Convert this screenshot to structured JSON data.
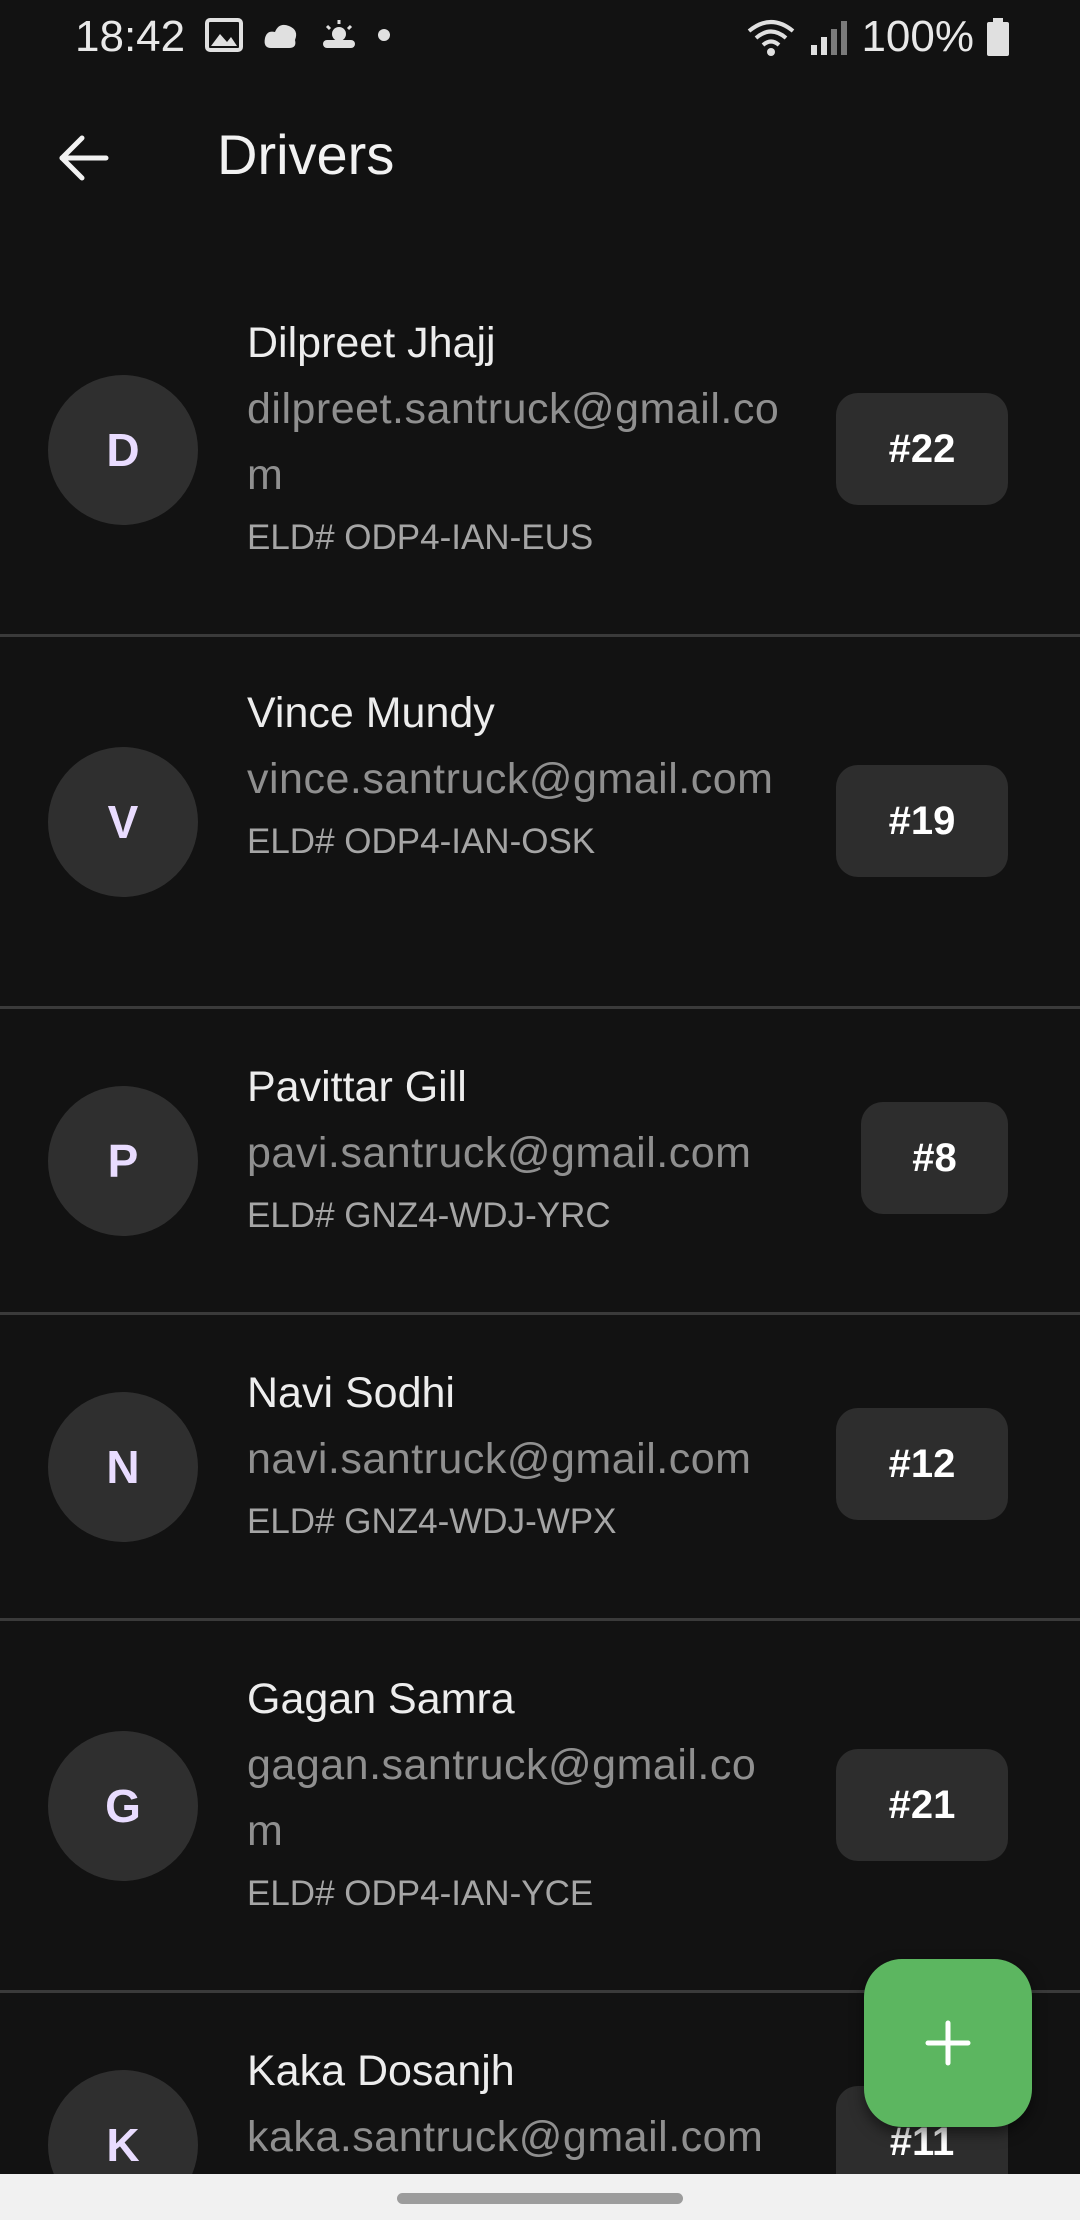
{
  "status_bar": {
    "time": "18:42",
    "battery_percent": "100%",
    "left_icons": [
      "image-icon",
      "cloud-icon",
      "weather-icon",
      "dot-icon"
    ],
    "right_icons": [
      "wifi-icon",
      "signal-icon",
      "battery-icon"
    ]
  },
  "app_bar": {
    "title": "Drivers",
    "back_icon": "arrow-left-icon"
  },
  "drivers": [
    {
      "initial": "D",
      "name": "Dilpreet Jhajj",
      "email": "dilpreet.santruck@gmail.com",
      "eld": "ELD# ODP4-IAN-EUS",
      "number": "#22"
    },
    {
      "initial": "V",
      "name": "Vince Mundy",
      "email": "vince.santruck@gmail.com",
      "eld": "ELD# ODP4-IAN-OSK",
      "number": "#19"
    },
    {
      "initial": "P",
      "name": "Pavittar Gill",
      "email": "pavi.santruck@gmail.com",
      "eld": "ELD# GNZ4-WDJ-YRC",
      "number": "#8"
    },
    {
      "initial": "N",
      "name": "Navi Sodhi",
      "email": "navi.santruck@gmail.com",
      "eld": "ELD# GNZ4-WDJ-WPX",
      "number": "#12"
    },
    {
      "initial": "G",
      "name": "Gagan Samra",
      "email": "gagan.santruck@gmail.com",
      "eld": "ELD# ODP4-IAN-YCE",
      "number": "#21"
    },
    {
      "initial": "K",
      "name": "Kaka Dosanjh",
      "email": "kaka.santruck@gmail.com",
      "eld": "",
      "number": "#11"
    }
  ],
  "fab": {
    "icon": "plus-icon"
  },
  "colors": {
    "background": "#121212",
    "fab": "#5cb660",
    "avatar_bg": "#2f2f2f",
    "badge_bg": "#2d2d2d"
  }
}
